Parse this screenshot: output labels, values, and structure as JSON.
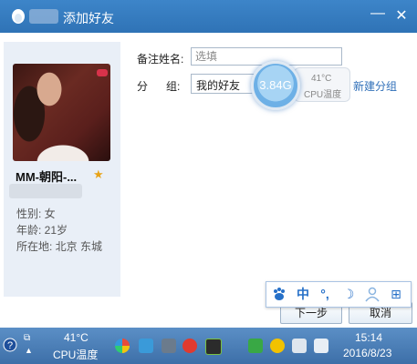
{
  "dialog": {
    "title": "添加好友",
    "minimize_label": "—",
    "close_label": "✕"
  },
  "profile": {
    "nickname": "MM-朝阳-...",
    "gender": "性别: 女",
    "age": "年龄: 21岁",
    "location": "所在地: 北京  东城"
  },
  "form": {
    "remark_label": "备注姓名:",
    "remark_placeholder": "选填",
    "group_label": "分      组:",
    "group_value": "我的好友",
    "new_group_link": "新建分组"
  },
  "speed_widget": {
    "value": "3.84G",
    "cpu_temp": "41°C",
    "cpu_label": "CPU温度"
  },
  "buttons": {
    "next": "下一步",
    "cancel": "取消"
  },
  "ime_bar": {
    "items": [
      "中",
      "°,",
      "☽",
      "⊞"
    ]
  },
  "taskbar": {
    "cpu_temp": "41°C",
    "cpu_label": "CPU温度",
    "time": "15:14",
    "date": "2016/8/23"
  },
  "colors": {
    "titlebar": "#2f73b6",
    "link": "#2f6fb8",
    "star": "#e8a317",
    "taskbar": "#4a7fb8"
  }
}
